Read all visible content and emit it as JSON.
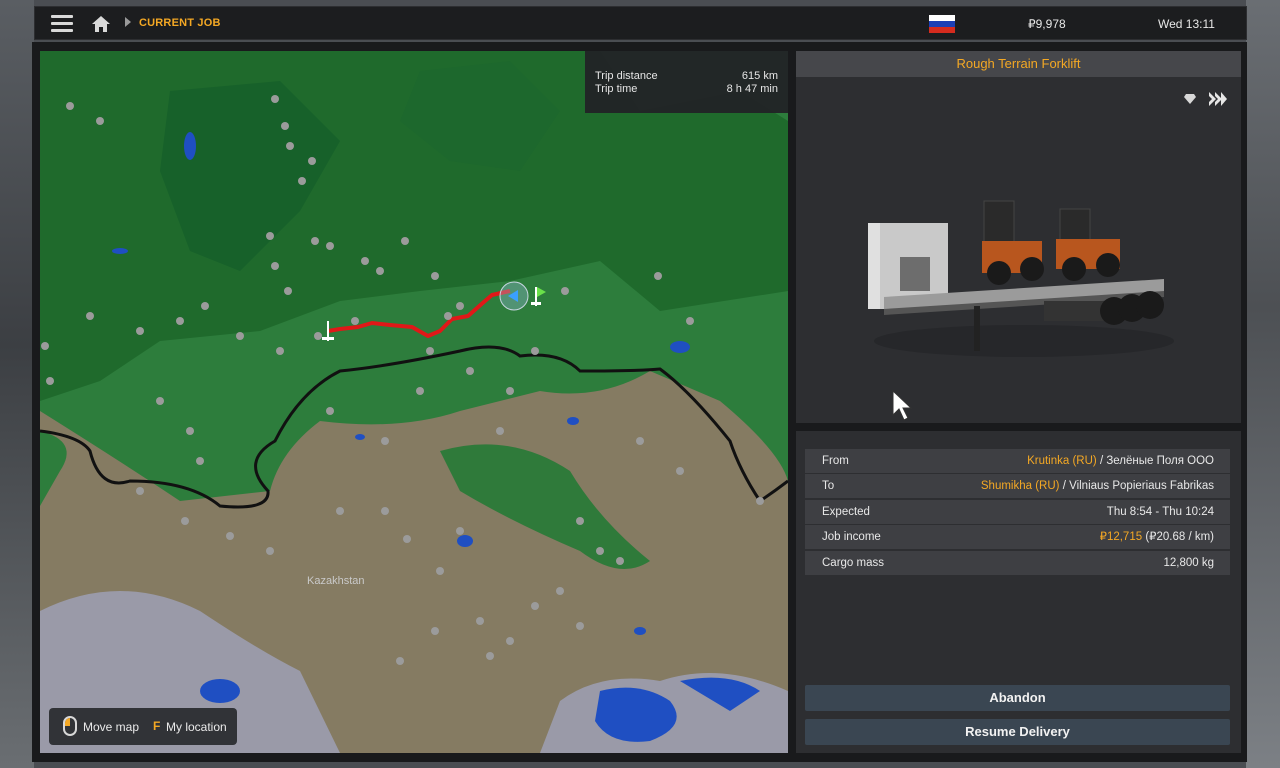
{
  "header": {
    "breadcrumb": "CURRENT JOB",
    "money": "₽9,978",
    "datetime": "Wed 13:11",
    "flag_colors": [
      "#ffffff",
      "#1c3fb5",
      "#d52b1e"
    ]
  },
  "map": {
    "trip_distance_label": "Trip distance",
    "trip_distance_value": "615 km",
    "trip_time_label": "Trip time",
    "trip_time_value": "8 h 47 min",
    "region_label": "Kazakhstan",
    "controls": {
      "move_label": "Move map",
      "location_key": "F",
      "location_label": "My location"
    },
    "route_color": "#e01818"
  },
  "cargo": {
    "name": "Rough Terrain Forklift",
    "icons": [
      "fragile-gem-icon",
      "skip-forward-icon"
    ]
  },
  "details": {
    "rows": [
      {
        "label": "From",
        "city": "Krutinka (RU)",
        "company": "Зелёные Поля ООО"
      },
      {
        "label": "To",
        "city": "Shumikha (RU)",
        "company": "Vilniaus Popieriaus Fabrikas"
      },
      {
        "label": "Expected",
        "value": "Thu 8:54 - Thu 10:24"
      },
      {
        "label": "Job income",
        "value_highlight": "₽12,715",
        "value_extra": "(₽20.68 / km)"
      },
      {
        "label": "Cargo mass",
        "value": "12,800 kg"
      }
    ],
    "separator": "/"
  },
  "buttons": {
    "abandon": "Abandon",
    "resume": "Resume Delivery"
  },
  "colors": {
    "accent": "#f4a824",
    "panel": "#2d2e31",
    "button": "#3a4652"
  }
}
